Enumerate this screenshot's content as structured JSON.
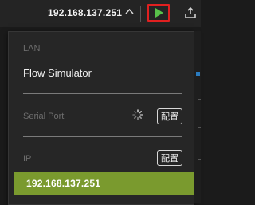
{
  "topbar": {
    "device_ip": "192.168.137.251",
    "chevron": "^",
    "play_icon": "play-icon",
    "export_icon": "export-icon"
  },
  "dropdown": {
    "lan_label": "LAN",
    "flow_simulator": "Flow Simulator",
    "serial_port_label": "Serial Port",
    "serial_config_button": "配置",
    "ip_label": "IP",
    "ip_config_button": "配置",
    "selected_ip": "192.168.137.251"
  },
  "colors": {
    "selection": "#7a9a2e",
    "play_green": "#58c24a",
    "highlight_red": "#e02020"
  }
}
